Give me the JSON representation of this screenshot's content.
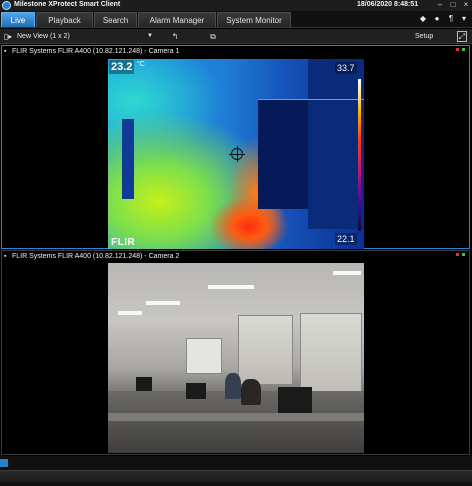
{
  "app": {
    "title": "Milestone XProtect Smart Client",
    "datetime": "18/06/2020 8:48:51"
  },
  "tabs": [
    {
      "label": "Live",
      "active": true
    },
    {
      "label": "Playback",
      "active": false
    },
    {
      "label": "Search",
      "active": false
    },
    {
      "label": "Alarm Manager",
      "active": false
    },
    {
      "label": "System Monitor",
      "active": false
    }
  ],
  "toolbar": {
    "view_name": "New View (1 x 2)",
    "setup_label": "Setup"
  },
  "cameras": [
    {
      "title": "FLIR Systems FLIR A400 (10.82.121.248) - Camera 1",
      "spot_temp": "23.2",
      "unit": "°C",
      "scale_max": "33.7",
      "scale_min": "22.1",
      "logo_text": "FLIR"
    },
    {
      "title": "FLIR Systems FLIR A400 (10.82.121.248) - Camera 2"
    }
  ],
  "colors": {
    "accent": "#2c86d8",
    "recording": "#d83a2a",
    "live": "#3ac24a"
  }
}
